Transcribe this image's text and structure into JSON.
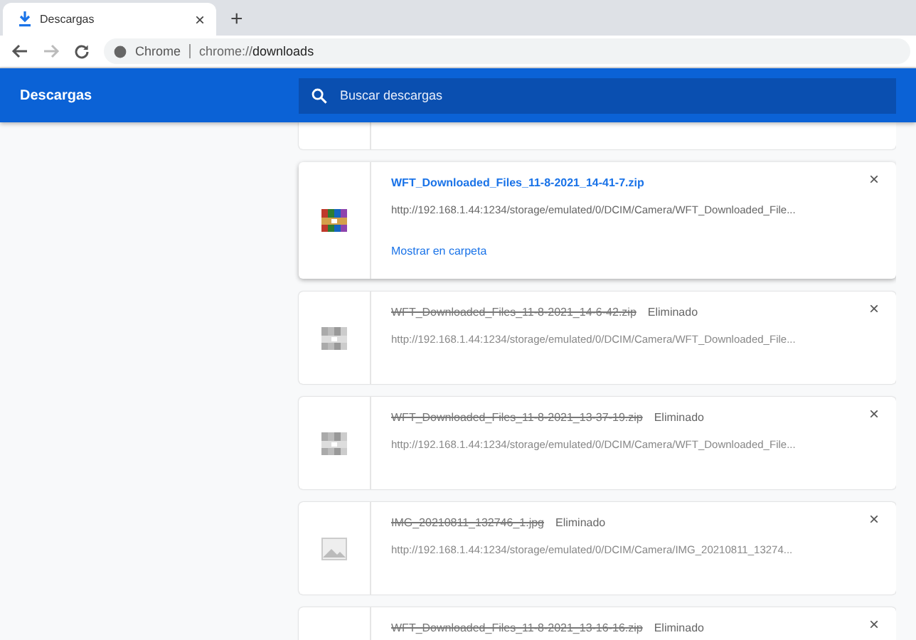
{
  "browser": {
    "tab_title": "Descargas",
    "new_tab": "+",
    "close_tab": "×",
    "site_label": "Chrome",
    "url_scheme": "chrome://",
    "url_host": "downloads"
  },
  "header": {
    "title": "Descargas",
    "search_placeholder": "Buscar descargas"
  },
  "downloads": [
    {
      "kind": "archive",
      "name": "WFT_Downloaded_Files_11-8-2021_14-41-7.zip",
      "removed": false,
      "url": "http://192.168.1.44:1234/storage/emulated/0/DCIM/Camera/WFT_Downloaded_File...",
      "action": "Mostrar en carpeta",
      "close": "×"
    },
    {
      "kind": "archive",
      "name": "WFT_Downloaded_Files_11-8-2021_14-6-42.zip",
      "removed": true,
      "status": "Eliminado",
      "url": "http://192.168.1.44:1234/storage/emulated/0/DCIM/Camera/WFT_Downloaded_File...",
      "close": "×"
    },
    {
      "kind": "archive",
      "name": "WFT_Downloaded_Files_11-8-2021_13-37-19.zip",
      "removed": true,
      "status": "Eliminado",
      "url": "http://192.168.1.44:1234/storage/emulated/0/DCIM/Camera/WFT_Downloaded_File...",
      "close": "×"
    },
    {
      "kind": "image",
      "name": "IMG_20210811_132746_1.jpg",
      "removed": true,
      "status": "Eliminado",
      "url": "http://192.168.1.44:1234/storage/emulated/0/DCIM/Camera/IMG_20210811_13274...",
      "close": "×"
    },
    {
      "kind": "archive",
      "name": "WFT_Downloaded_Files_11-8-2021_13-16-16.zip",
      "removed": true,
      "status": "Eliminado",
      "close": "×"
    }
  ]
}
